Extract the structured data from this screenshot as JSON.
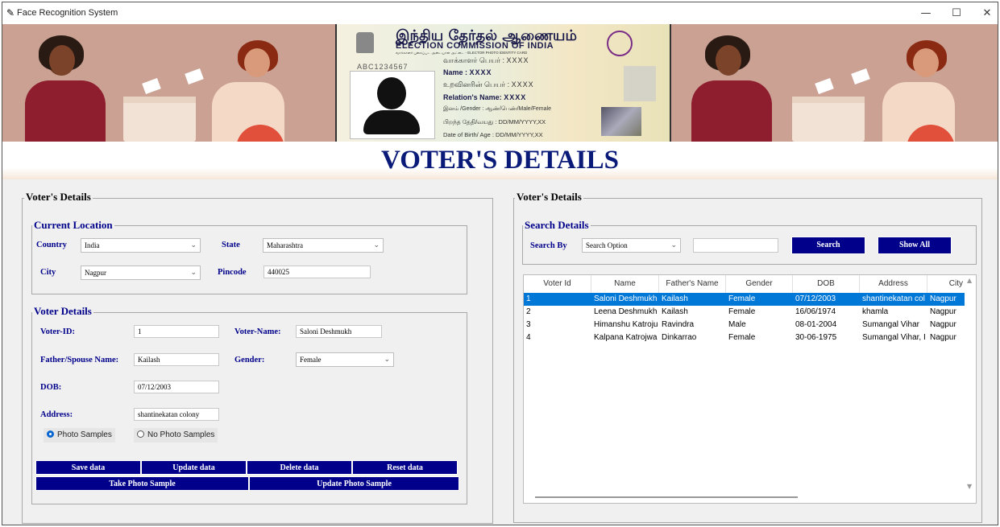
{
  "window": {
    "title": "Face Recognition System",
    "minimize": "—",
    "maximize": "☐",
    "close": "✕"
  },
  "banner": {
    "card": {
      "tamil_title": "இந்திய தேர்தல் ஆணையம்",
      "eci": "ELECTION COMMISSION OF INDIA",
      "sub": "வாக்காளர் புகைப்பட அடையாள அட்டை - ELECTOR PHOTO IDENTITY CARD",
      "epic": "ABC1234567",
      "l1_label": "வாக்காளர் பெயர் :",
      "l1_value": "XXXX",
      "l2_label": "Name :",
      "l2_value": "XXXX",
      "l3_label": "உறவினரின் பெயர் :",
      "l3_value": "XXXX",
      "l4_label": "Relation's Name:",
      "l4_value": "XXXX",
      "l5": "இனம் /Gender : ஆண்/பெண்/Male/Female",
      "l6": "பிறந்த தேதி/வயது : DD/MM/YYYY,XX",
      "l7": "Date of Birth/ Age : DD/MM/YYYY,XX"
    }
  },
  "heading": "VOTER'S DETAILS",
  "left": {
    "legend": "Voter's Details",
    "current_location": {
      "legend": "Current Location",
      "country_label": "Country",
      "country_value": "India",
      "state_label": "State",
      "state_value": "Maharashtra",
      "city_label": "City",
      "city_value": "Nagpur",
      "pincode_label": "Pincode",
      "pincode_value": "440025"
    },
    "voter_details": {
      "legend": "Voter Details",
      "voter_id_label": "Voter-ID:",
      "voter_id_value": "1",
      "voter_name_label": "Voter-Name:",
      "voter_name_value": "Saloni Deshmukh",
      "father_label": "Father/Spouse Name:",
      "father_value": "Kailash",
      "gender_label": "Gender:",
      "gender_value": "Female",
      "dob_label": "DOB:",
      "dob_value": "07/12/2003",
      "address_label": "Address:",
      "address_value": "shantinekatan colony",
      "photo_samples": "Photo Samples",
      "no_photo_samples": "No Photo Samples"
    },
    "buttons": {
      "save": "Save data",
      "update": "Update data",
      "delete": "Delete data",
      "reset": "Reset data",
      "take_photo": "Take Photo Sample",
      "update_photo": "Update Photo Sample"
    }
  },
  "right": {
    "legend": "Voter's Details",
    "search": {
      "legend": "Search Details",
      "search_by_label": "Search By",
      "search_option": "Search Option",
      "search_button": "Search",
      "show_all_button": "Show All"
    },
    "table": {
      "columns": [
        "Voter Id",
        "Name",
        "Father's Name",
        "Gender",
        "DOB",
        "Address",
        "City"
      ],
      "rows": [
        [
          "1",
          "Saloni Deshmukh",
          "Kailash",
          "Female",
          "07/12/2003",
          "shantinekatan col",
          "Nagpur"
        ],
        [
          "2",
          "Leena Deshmukh",
          "Kailash",
          "Female",
          "16/06/1974",
          "khamla",
          "Nagpur"
        ],
        [
          "3",
          "Himanshu Katroju",
          "Ravindra",
          "Male",
          "08-01-2004",
          "Sumangal Vihar",
          "Nagpur"
        ],
        [
          "4",
          "Kalpana Katrojwa",
          "Dinkarrao",
          "Female",
          "30-06-1975",
          "Sumangal Vihar, I",
          "Nagpur"
        ]
      ]
    }
  },
  "colors": {
    "accent": "#00008b",
    "heading": "#0a1a78",
    "selection": "#0078d7"
  }
}
